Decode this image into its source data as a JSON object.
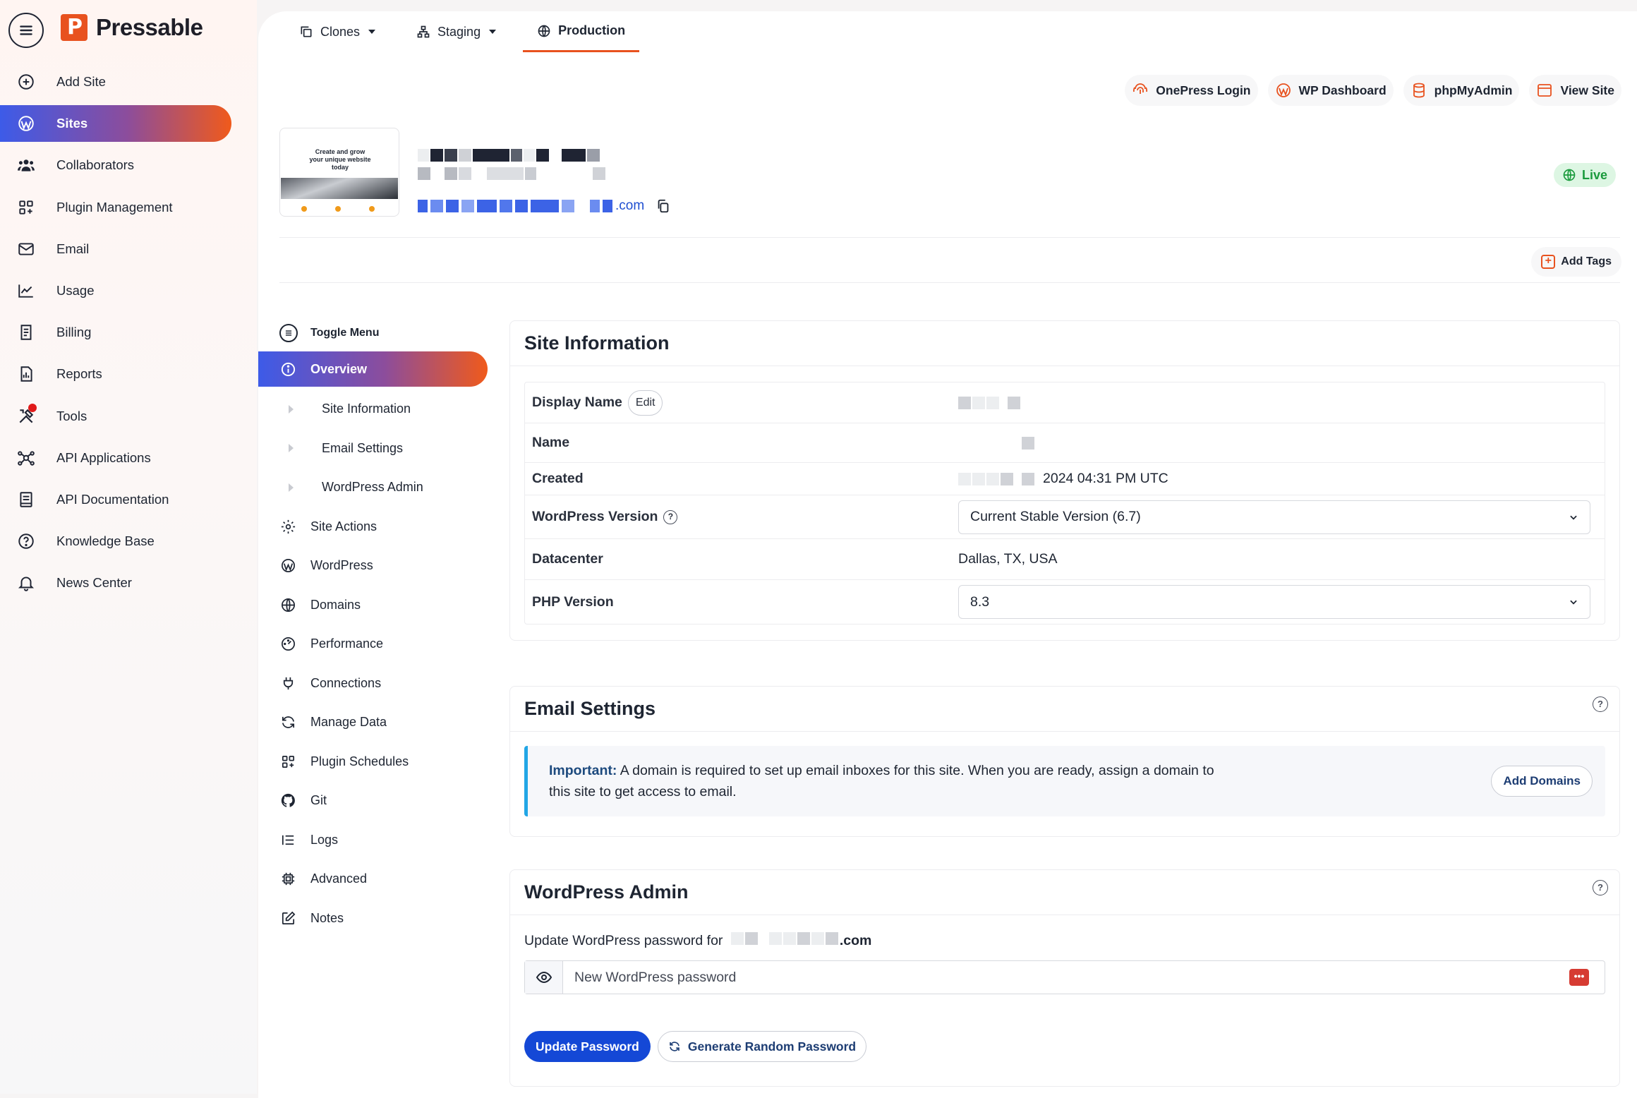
{
  "brand": {
    "name": "Pressable",
    "logo_letter": "P"
  },
  "sidebar": {
    "items": [
      {
        "label": "Add Site",
        "icon": "plus-circle-icon",
        "active": false
      },
      {
        "label": "Sites",
        "icon": "wordpress-icon",
        "active": true
      },
      {
        "label": "Collaborators",
        "icon": "users-icon",
        "active": false
      },
      {
        "label": "Plugin Management",
        "icon": "grid-plus-icon",
        "active": false
      },
      {
        "label": "Email",
        "icon": "envelope-icon",
        "active": false
      },
      {
        "label": "Usage",
        "icon": "line-chart-icon",
        "active": false
      },
      {
        "label": "Billing",
        "icon": "invoice-icon",
        "active": false
      },
      {
        "label": "Reports",
        "icon": "report-icon",
        "active": false
      },
      {
        "label": "Tools",
        "icon": "tools-icon",
        "active": false
      },
      {
        "label": "API Applications",
        "icon": "network-icon",
        "active": false
      },
      {
        "label": "API Documentation",
        "icon": "book-icon",
        "active": false
      },
      {
        "label": "Knowledge Base",
        "icon": "question-circle-icon",
        "active": false
      },
      {
        "label": "News Center",
        "icon": "bell-icon",
        "active": false
      }
    ]
  },
  "tabs": [
    {
      "label": "Clones",
      "icon": "clone-icon",
      "dropdown": true
    },
    {
      "label": "Staging",
      "icon": "sitemap-icon",
      "dropdown": true
    },
    {
      "label": "Production",
      "icon": "globe-icon",
      "dropdown": false
    }
  ],
  "quick_links": [
    {
      "label": "OnePress Login",
      "icon": "fingerprint-icon"
    },
    {
      "label": "WP Dashboard",
      "icon": "wordpress-icon"
    },
    {
      "label": "phpMyAdmin",
      "icon": "database-icon"
    },
    {
      "label": "View Site",
      "icon": "browser-icon"
    }
  ],
  "site": {
    "thumbnail_headline": "Create and grow your unique website today",
    "url_suffix": ".com",
    "status": "Live"
  },
  "add_tags_label": "Add Tags",
  "submenu": {
    "toggle_label": "Toggle Menu",
    "items": [
      {
        "label": "Overview",
        "icon": "info-icon",
        "active": true,
        "child": false
      },
      {
        "label": "Site Information",
        "icon": "triangle-right-icon",
        "active": false,
        "child": true
      },
      {
        "label": "Email Settings",
        "icon": "triangle-right-icon",
        "active": false,
        "child": true
      },
      {
        "label": "WordPress Admin",
        "icon": "triangle-right-icon",
        "active": false,
        "child": true
      },
      {
        "label": "Site Actions",
        "icon": "gear-icon",
        "active": false,
        "child": false
      },
      {
        "label": "WordPress",
        "icon": "wordpress-icon",
        "active": false,
        "child": false
      },
      {
        "label": "Domains",
        "icon": "globe-icon",
        "active": false,
        "child": false
      },
      {
        "label": "Performance",
        "icon": "gauge-icon",
        "active": false,
        "child": false
      },
      {
        "label": "Connections",
        "icon": "plug-icon",
        "active": false,
        "child": false
      },
      {
        "label": "Manage Data",
        "icon": "sync-icon",
        "active": false,
        "child": false
      },
      {
        "label": "Plugin Schedules",
        "icon": "grid-plus-icon",
        "active": false,
        "child": false
      },
      {
        "label": "Git",
        "icon": "github-icon",
        "active": false,
        "child": false
      },
      {
        "label": "Logs",
        "icon": "list-icon",
        "active": false,
        "child": false
      },
      {
        "label": "Advanced",
        "icon": "chip-icon",
        "active": false,
        "child": false
      },
      {
        "label": "Notes",
        "icon": "edit-icon",
        "active": false,
        "child": false
      }
    ]
  },
  "site_info": {
    "title": "Site Information",
    "display_name_label": "Display Name",
    "edit_label": "Edit",
    "name_label": "Name",
    "created_label": "Created",
    "created_value": "2024 04:31 PM UTC",
    "wp_version_label": "WordPress Version",
    "wp_version_value": "Current Stable Version (6.7)",
    "datacenter_label": "Datacenter",
    "datacenter_value": "Dallas, TX, USA",
    "php_version_label": "PHP Version",
    "php_version_value": "8.3"
  },
  "email_settings": {
    "title": "Email Settings",
    "important_label": "Important:",
    "notice_text": "A domain is required to set up email inboxes for this site. When you are ready, assign a domain to this site to get access to email.",
    "add_domains_label": "Add Domains"
  },
  "wp_admin": {
    "title": "WordPress Admin",
    "update_prefix": "Update WordPress password for",
    "domain_suffix": ".com",
    "password_placeholder": "New WordPress password",
    "update_button": "Update Password",
    "generate_button": "Generate Random Password"
  },
  "colors": {
    "accent": "#e8521f",
    "primary_blue": "#1448d6",
    "live_green": "#1a9a3c",
    "notice_border": "#22a6e6"
  }
}
